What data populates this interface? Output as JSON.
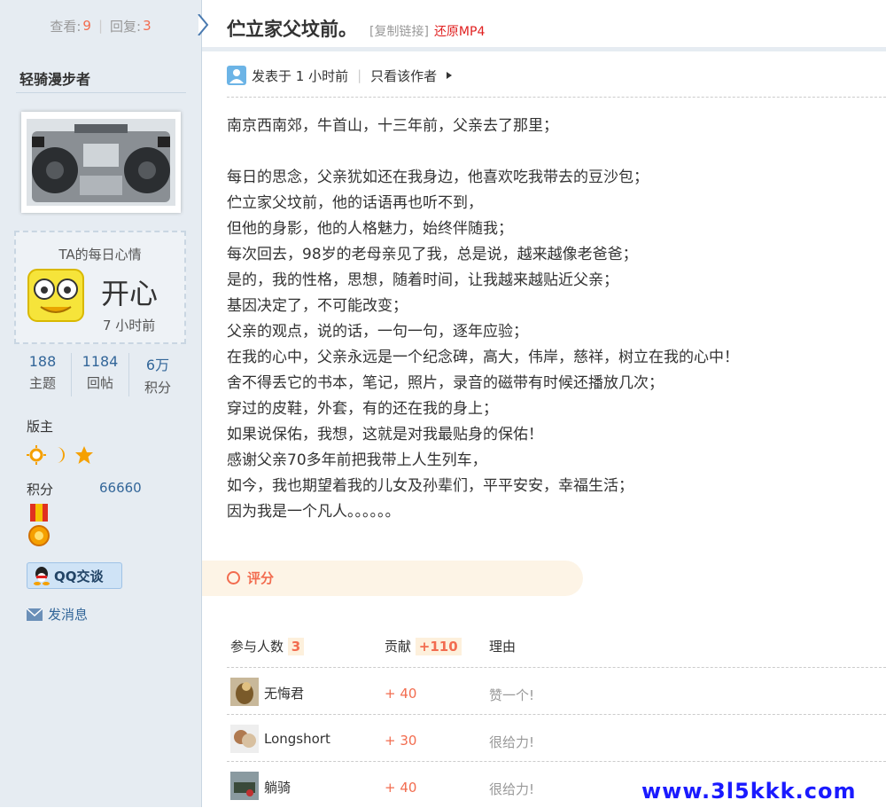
{
  "stats": {
    "views_label": "查看:",
    "views": "9",
    "replies_label": "回复:",
    "replies": "3"
  },
  "thread": {
    "title": "伫立家父坟前。",
    "copy_link": "[复制链接]",
    "restore": "还原MP4"
  },
  "user": {
    "name": "轻骑漫步者",
    "mood": {
      "title": "TA的每日心情",
      "word": "开心",
      "time": "7 小时前"
    },
    "counts": [
      {
        "value": "188",
        "label": "主题"
      },
      {
        "value": "1184",
        "label": "回帖"
      },
      {
        "value": "6万",
        "label": "积分"
      }
    ],
    "role": "版主",
    "points_label": "积分",
    "points": "66660",
    "qq_label": "QQ交谈",
    "message_label": "发消息"
  },
  "post": {
    "posted": "发表于 1 小时前",
    "only_author": "只看该作者",
    "lines": [
      "南京西南郊，牛首山，十三年前，父亲去了那里；",
      "",
      "每日的思念，父亲犹如还在我身边，他喜欢吃我带去的豆沙包；",
      "伫立家父坟前，他的话语再也听不到，",
      "但他的身影，他的人格魅力，始终伴随我；",
      "每次回去，98岁的老母亲见了我，总是说，越来越像老爸爸；",
      "是的，我的性格，思想，随着时间，让我越来越贴近父亲；",
      "基因决定了，不可能改变；",
      "父亲的观点，说的话，一句一句，逐年应验；",
      "在我的心中，父亲永远是一个纪念碑，高大，伟岸，慈祥，树立在我的心中！",
      "舍不得丢它的书本，笔记，照片，录音的磁带有时候还播放几次；",
      "穿过的皮鞋，外套，有的还在我的身上；",
      "如果说保佑，我想，这就是对我最贴身的保佑！",
      "感谢父亲70多年前把我带上人生列车，",
      "如今，我也期望着我的儿女及孙辈们，平平安安，幸福生活；",
      "因为我是一个凡人。。。。。。"
    ]
  },
  "rating": {
    "tab_label": "评分",
    "participants_label": "参与人数",
    "participants": "3",
    "contribution_label": "贡献",
    "contribution": "+110",
    "reason_label": "理由",
    "rows": [
      {
        "name": "无悔君",
        "points": "+ 40",
        "reason": "赞一个!"
      },
      {
        "name": "Longshort",
        "points": "+ 30",
        "reason": "很给力!"
      },
      {
        "name": "躺骑",
        "points": "+ 40",
        "reason": "很给力!"
      }
    ]
  },
  "watermark": "www.3l5kkk.com",
  "colors": {
    "accent": "#f26c4f",
    "sidebar_bg": "#e6ecf2",
    "link": "#336699"
  }
}
